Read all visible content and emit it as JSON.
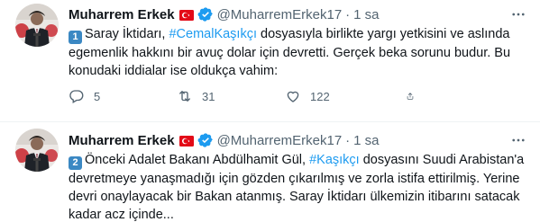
{
  "tweets": [
    {
      "author_name": "Muharrem Erkek",
      "handle": "@MuharremErkek17",
      "separator": "·",
      "time": "1 sa",
      "number_badge": "1",
      "text_before": "Saray İktidarı, ",
      "hashtag": "#CemalKaşıkçı",
      "text_after": " dosyasıyla birlikte yargı yetkisini ve aslında egemenlik hakkını bir avuç dolar için devretti. Gerçek beka sorunu budur. Bu konudaki iddialar ise oldukça vahim:",
      "replies": "5",
      "retweets": "31",
      "likes": "122"
    },
    {
      "author_name": "Muharrem Erkek",
      "handle": "@MuharremErkek17",
      "separator": "·",
      "time": "1 sa",
      "number_badge": "2",
      "text_before": "Önceki Adalet Bakanı Abdülhamit Gül, ",
      "hashtag": "#Kaşıkçı",
      "text_after": " dosyasını Suudi Arabistan'a devretmeye yanaşmadığı için gözden çıkarılmış ve zorla istifa ettirilmiş. Yerine devri onaylayacak bir Bakan atanmış. Saray İktidarı ülkemizin itibarını satacak kadar acz içinde..."
    }
  ],
  "colors": {
    "text": "#0f1419",
    "muted": "#536471",
    "link": "#1d9bf0",
    "verified": "#1d9bf0",
    "flag_red": "#e30a17",
    "keycap": "#3b88c3"
  },
  "icons": [
    "flag-turkey-icon",
    "verified-badge-icon",
    "more-icon",
    "reply-icon",
    "retweet-icon",
    "like-icon",
    "share-icon"
  ]
}
